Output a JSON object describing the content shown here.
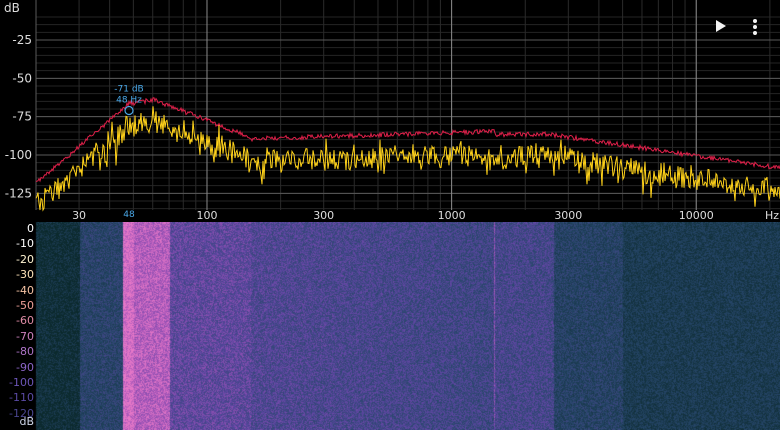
{
  "spectrum": {
    "unit_db": "dB",
    "unit_hz": "Hz",
    "y_ticks": [
      {
        "label": "-25",
        "value": -25
      },
      {
        "label": "-50",
        "value": -50
      },
      {
        "label": "-75",
        "value": -75
      },
      {
        "label": "-100",
        "value": -100
      },
      {
        "label": "-125",
        "value": -125
      }
    ],
    "x_ticks": [
      {
        "label": "30",
        "value": 30
      },
      {
        "label": "100",
        "value": 100
      },
      {
        "label": "300",
        "value": 300
      },
      {
        "label": "1000",
        "value": 1000
      },
      {
        "label": "3000",
        "value": 3000
      },
      {
        "label": "10000",
        "value": 10000
      }
    ],
    "peak": {
      "db_label": "-71 dB",
      "hz_label": "48 Hz",
      "axis_label": "48",
      "hz": 48,
      "db": -71
    },
    "colors": {
      "live": "#ffd21a",
      "peak_hold": "#e0204a",
      "cursor": "#4aa8e8",
      "grid": "#5a5a5a"
    }
  },
  "spectrogram": {
    "unit_db": "dB",
    "ticks": [
      {
        "label": "0",
        "color": "#ffffff"
      },
      {
        "label": "-10",
        "color": "#ffffff"
      },
      {
        "label": "-20",
        "color": "#fff4d2"
      },
      {
        "label": "-30",
        "color": "#fde2b8"
      },
      {
        "label": "-40",
        "color": "#f6c3a4"
      },
      {
        "label": "-50",
        "color": "#ee9f98"
      },
      {
        "label": "-60",
        "color": "#e08ca6"
      },
      {
        "label": "-70",
        "color": "#cc80bb"
      },
      {
        "label": "-80",
        "color": "#ae74c8"
      },
      {
        "label": "-90",
        "color": "#8a64c6"
      },
      {
        "label": "-100",
        "color": "#6c56b8"
      },
      {
        "label": "-110",
        "color": "#5a4aa4"
      },
      {
        "label": "-120",
        "color": "#4a4690"
      }
    ]
  },
  "controls": {
    "play": "play-icon",
    "menu": "more-vertical-icon"
  }
}
